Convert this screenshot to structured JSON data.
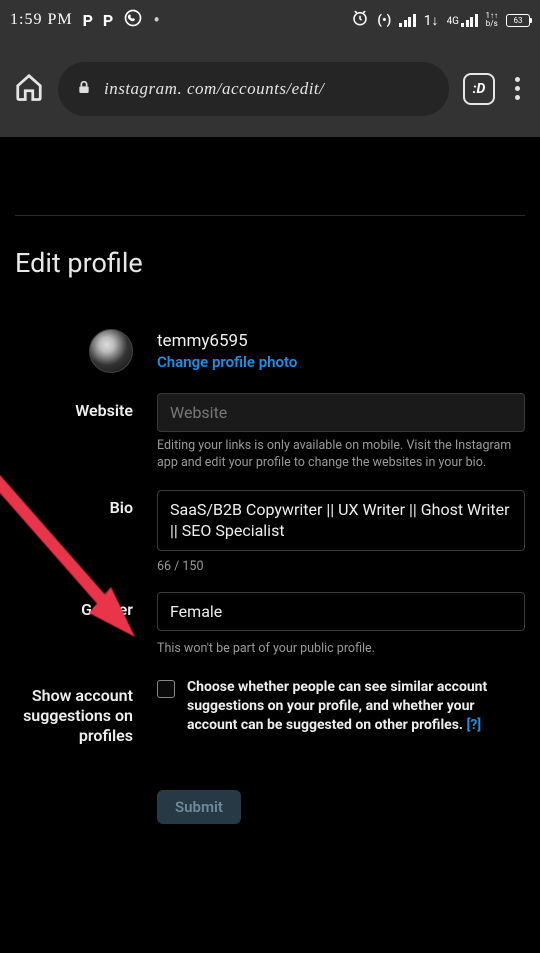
{
  "status": {
    "time": "1:59 PM",
    "p1": "P",
    "p2": "P",
    "whatsapp": "whatsapp-icon",
    "dot": "•",
    "alarm": "⏰",
    "hotspot": "((•))",
    "network_4g": "4G",
    "data_rate": "1↑↑\nb/s",
    "battery_pct": "63"
  },
  "browser": {
    "url": "instagram. com/accounts/edit/",
    "tab_count": ":D"
  },
  "page": {
    "title": "Edit profile"
  },
  "profile": {
    "username": "temmy6595",
    "change_photo_label": "Change profile photo"
  },
  "fields": {
    "website": {
      "label": "Website",
      "placeholder": "Website",
      "help": "Editing your links is only available on mobile. Visit the Instagram app and edit your profile to change the websites in your bio."
    },
    "bio": {
      "label": "Bio",
      "value": "SaaS/B2B Copywriter || UX Writer || Ghost Writer || SEO Specialist",
      "counter": "66 / 150"
    },
    "gender": {
      "label": "Gender",
      "value": "Female",
      "help": "This won't be part of your public profile."
    },
    "suggestions": {
      "label": "Show account suggestions on profiles",
      "text": "Choose whether people can see similar account suggestions on your profile, and whether your account can be suggested on other profiles.  ",
      "help_link": "[?]"
    }
  },
  "submit": {
    "label": "Submit"
  }
}
